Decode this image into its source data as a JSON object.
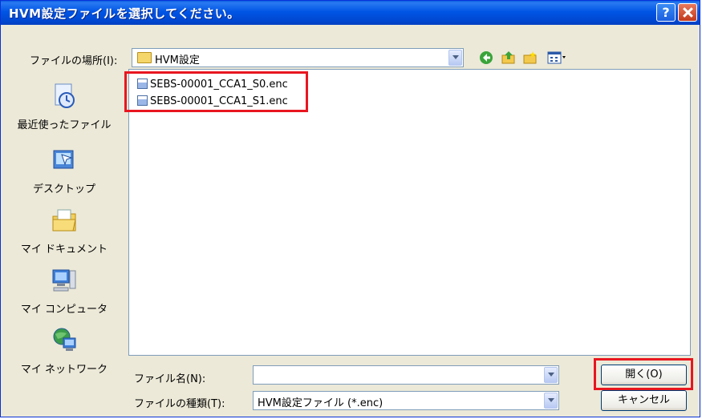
{
  "window": {
    "title": "HVM設定ファイルを選択してください。",
    "help_label": "?"
  },
  "lookin": {
    "label": "ファイルの場所(I):",
    "value": "HVM設定"
  },
  "toolbar": [
    "back-icon",
    "up-folder-icon",
    "new-folder-icon",
    "view-menu-icon"
  ],
  "places": [
    {
      "label": "最近使ったファイル",
      "icon": "recent-files-icon"
    },
    {
      "label": "デスクトップ",
      "icon": "desktop-icon"
    },
    {
      "label": "マイ ドキュメント",
      "icon": "my-documents-icon"
    },
    {
      "label": "マイ コンピュータ",
      "icon": "my-computer-icon"
    },
    {
      "label": "マイ ネットワーク",
      "icon": "my-network-icon"
    }
  ],
  "files": [
    "SEBS-00001_CCA1_S0.enc",
    "SEBS-00001_CCA1_S1.enc"
  ],
  "filename": {
    "label": "ファイル名(N):",
    "value": ""
  },
  "filetype": {
    "label": "ファイルの種類(T):",
    "value": "HVM設定ファイル (*.enc)"
  },
  "buttons": {
    "open": "開く(O)",
    "cancel": "キャンセル"
  },
  "highlight_color": "#e8161f"
}
